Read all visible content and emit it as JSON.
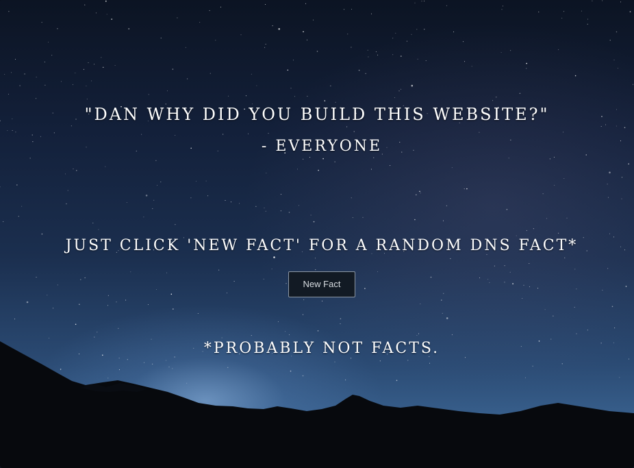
{
  "hero": {
    "quote": "\"Dan why did you build this website?\"",
    "attribution": "- Everyone",
    "instruction": "Just click 'New Fact' for a random DNS fact*",
    "button_label": "New Fact",
    "footnote": "*Probably not facts."
  },
  "background": {
    "scene": "night-sky-with-mountain-silhouette",
    "colors": {
      "sky_top": "#0c1423",
      "sky_horizon": "#3b6492",
      "mountains": "#07090d",
      "button_bg": "#121a24",
      "button_border": "#8e98a4",
      "text": "#ffffff"
    }
  }
}
